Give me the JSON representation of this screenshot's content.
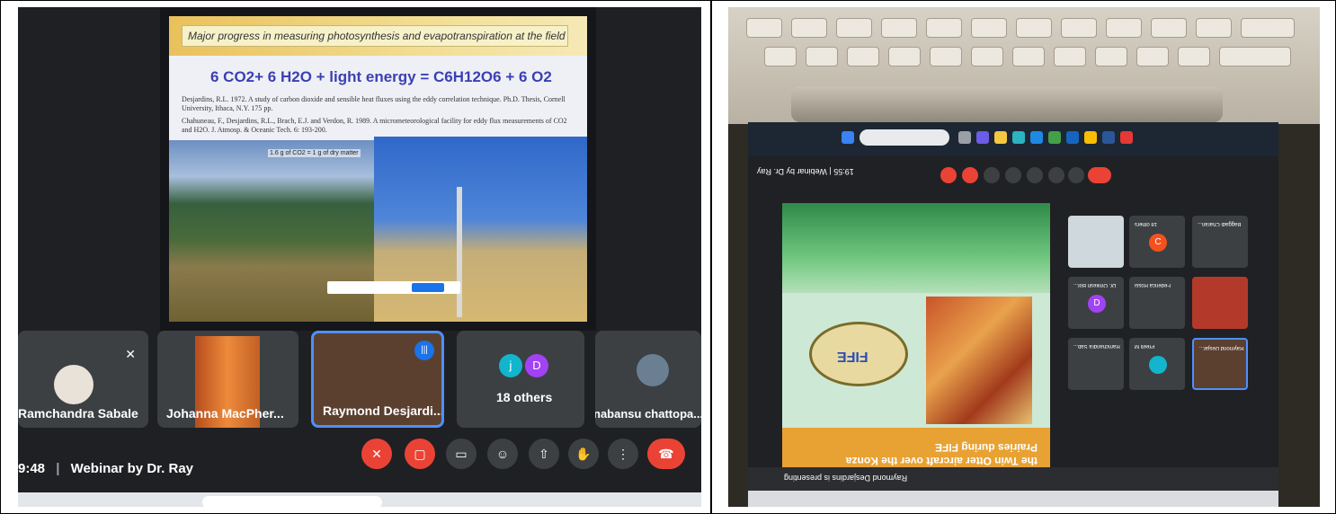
{
  "left_photo": {
    "slide": {
      "title": "Major progress in measuring photosynthesis and evapotranspiration at the field scale",
      "equation": "6 CO2+ 6 H2O + light energy = C6H12O6 + 6 O2",
      "reference_1": "Desjardins, R.L. 1972. A study of carbon dioxide and sensible heat fluxes using the eddy correlation technique. Ph.D. Thesis, Cornell University, Ithaca, N.Y. 175 pp.",
      "reference_2": "Chahuneau, F., Desjardins, R.L., Brach, E.J. and Verdon, R. 1989. A micrometeorological facility for eddy flux measurements of CO2 and H2O. J. Atmosp. & Oceanic Tech. 6: 193-200.",
      "photo_caption": "1.6 g of CO2 = 1 g of dry matter"
    },
    "participants": [
      {
        "name": "Ramchandra Sabale"
      },
      {
        "name": "Johanna MacPher..."
      },
      {
        "name": "Raymond Desjardi..."
      },
      {
        "name": "18 others",
        "avatars": [
          "j",
          "D"
        ]
      },
      {
        "name": "nabansu chattopa..."
      }
    ],
    "meeting_time": "9:48",
    "meeting_title": "Webinar by Dr. Ray",
    "colors": {
      "accent": "#1a73e8",
      "hangup": "#ea4335",
      "tile": "#3c4043"
    }
  },
  "right_photo": {
    "meet_title": "19:55 | Webinar by Dr. Ray",
    "slide_footer": "Measurements of evapotranspiration using the Twin Otter aircraft over the Konza Prairies during FIFE",
    "fife_label": "FIFE",
    "presenting": "Raymond Desjardins is presenting",
    "grid_participants": [
      {
        "name": "Ramchandra Sab..."
      },
      {
        "name": "Preeti M"
      },
      {
        "name": "Raymond Desjar..."
      },
      {
        "name": "Dr. Omkesh Bor...",
        "initial": "D"
      },
      {
        "name": "Federica Rossi"
      },
      {
        "name": "18 others",
        "initial": "C"
      },
      {
        "name": "Baggadi Charan..."
      }
    ]
  }
}
